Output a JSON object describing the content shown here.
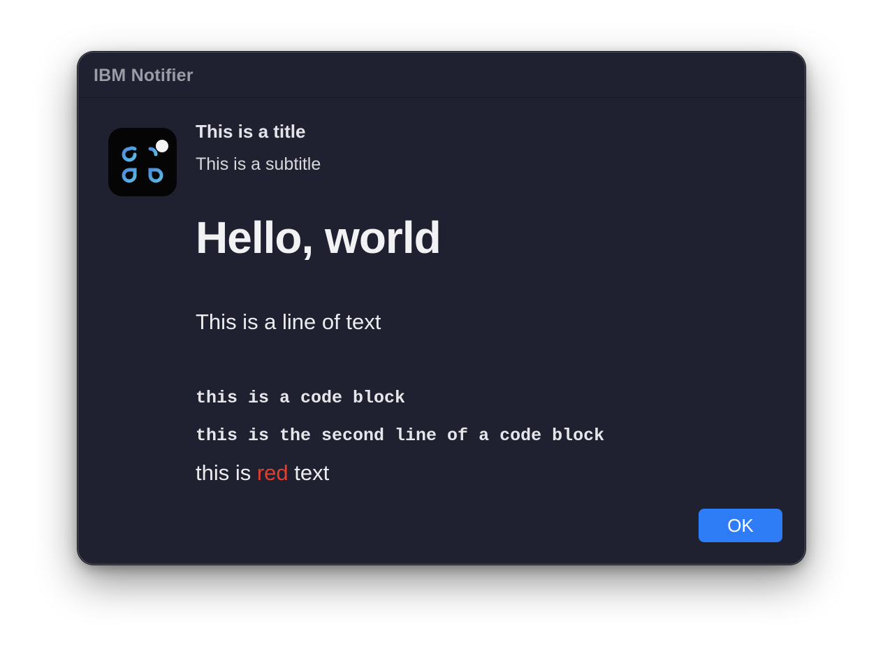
{
  "window": {
    "app_title": "IBM Notifier"
  },
  "icon": {
    "name": "command-key-icon",
    "badge": "notification-dot"
  },
  "notification": {
    "title": "This is a title",
    "subtitle": "This is a subtitle",
    "heading": "Hello, world",
    "text_line": "This is a line of text",
    "code_block": [
      "this is a code block",
      "this is the second line of a code block"
    ],
    "colored_line": {
      "before": "this is ",
      "highlight": "red",
      "after": " text",
      "highlight_color": "#e0402f"
    }
  },
  "buttons": {
    "ok_label": "OK",
    "ok_color": "#2f7df6"
  },
  "colors": {
    "window_background": "#1f2130",
    "text_primary": "#ececef"
  }
}
